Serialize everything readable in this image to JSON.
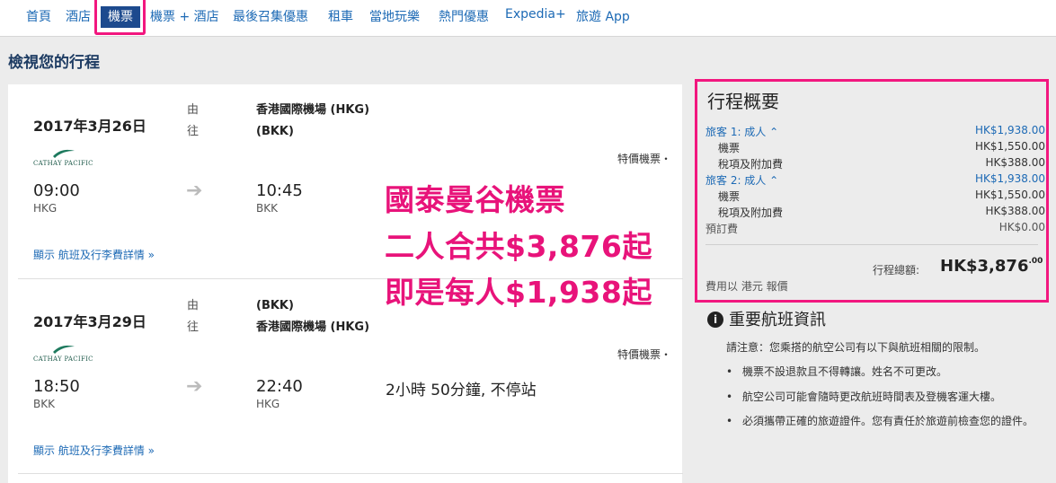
{
  "nav": {
    "items": [
      "首頁",
      "酒店",
      "機票",
      "機票 + 酒店",
      "最後召集優惠",
      "租車",
      "當地玩樂",
      "熱門優惠",
      "Expedia+",
      "旅遊 App"
    ]
  },
  "page_title": "檢視您的行程",
  "legs": [
    {
      "date": "2017年3月26日",
      "from_label": "由",
      "to_label": "往",
      "from_airport": "香港國際機場 (HKG)",
      "to_airport": "(BKK)",
      "airline": "CATHAY PACIFIC",
      "fare_type": "特價機票・",
      "depart_time": "09:00",
      "depart_code": "HKG",
      "arrive_time": "10:45",
      "arrive_code": "BKK",
      "details_link": "顯示 航班及行李費詳情 »"
    },
    {
      "date": "2017年3月29日",
      "from_label": "由",
      "to_label": "往",
      "from_airport": "(BKK)",
      "to_airport": "香港國際機場 (HKG)",
      "airline": "CATHAY PACIFIC",
      "fare_type": "特價機票・",
      "depart_time": "18:50",
      "depart_code": "BKK",
      "arrive_time": "22:40",
      "arrive_code": "HKG",
      "duration": "2小時 50分鐘, 不停站",
      "details_link": "顯示 航班及行李費詳情 »"
    }
  ],
  "promo": {
    "line1": "國泰曼谷機票",
    "line2": "二人合共$3,876起",
    "line3": "即是每人$1,938起"
  },
  "summary": {
    "title": "行程概要",
    "traveler1": {
      "label": "旅客 1: 成人 ⌃",
      "total": "HK$1,938.00",
      "ticket_label": "機票",
      "ticket": "HK$1,550.00",
      "tax_label": "稅項及附加費",
      "tax": "HK$388.00"
    },
    "traveler2": {
      "label": "旅客 2: 成人 ⌃",
      "total": "HK$1,938.00",
      "ticket_label": "機票",
      "ticket": "HK$1,550.00",
      "tax_label": "稅項及附加費",
      "tax": "HK$388.00"
    },
    "booking_fee_label": "預訂費",
    "booking_fee": "HK$0.00",
    "total_label": "行程總額:",
    "total_main": "HK$3,876",
    "total_cents": ".00",
    "currency_note": "費用以 港元 報價"
  },
  "info": {
    "icon": "i",
    "title": "重要航班資訊",
    "intro": "請注意：您乘搭的航空公司有以下與航班相關的限制。",
    "bullets": [
      "機票不設退款且不得轉讓。姓名不可更改。",
      "航空公司可能會隨時更改航班時間表及登機客運大樓。",
      "必須攜帶正確的旅遊證件。您有責任於旅遊前檢查您的證件。"
    ]
  }
}
